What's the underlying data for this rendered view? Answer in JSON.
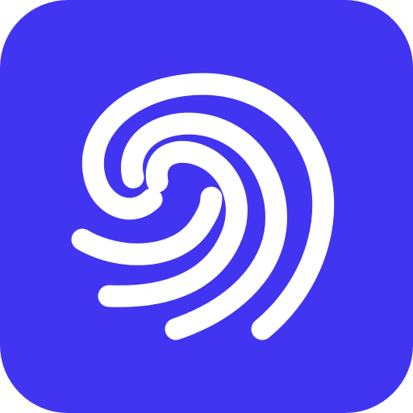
{
  "icon": {
    "name": "fingerprint-icon",
    "background_color": "#4135F1",
    "foreground_color": "#FFFFFF"
  }
}
